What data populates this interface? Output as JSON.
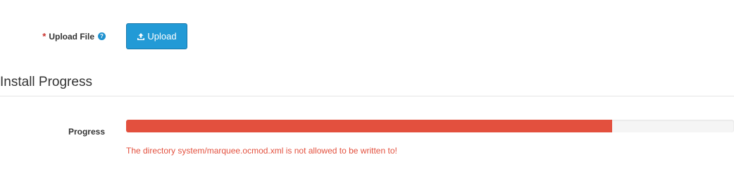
{
  "upload": {
    "required_marker": "*",
    "label": "Upload File",
    "help_icon": "question-circle-icon",
    "button_icon": "upload-icon",
    "button_label": "Upload"
  },
  "install_progress": {
    "title": "Install Progress",
    "progress_label": "Progress",
    "progress_fraction": 0.8,
    "error_message": "The directory system/marquee.ocmod.xml is not allowed to be written to!"
  },
  "colors": {
    "primary_button": "#229ad6",
    "progress_fill": "#e3503e",
    "error_text": "#e3503e",
    "required_star": "#c9302c"
  }
}
